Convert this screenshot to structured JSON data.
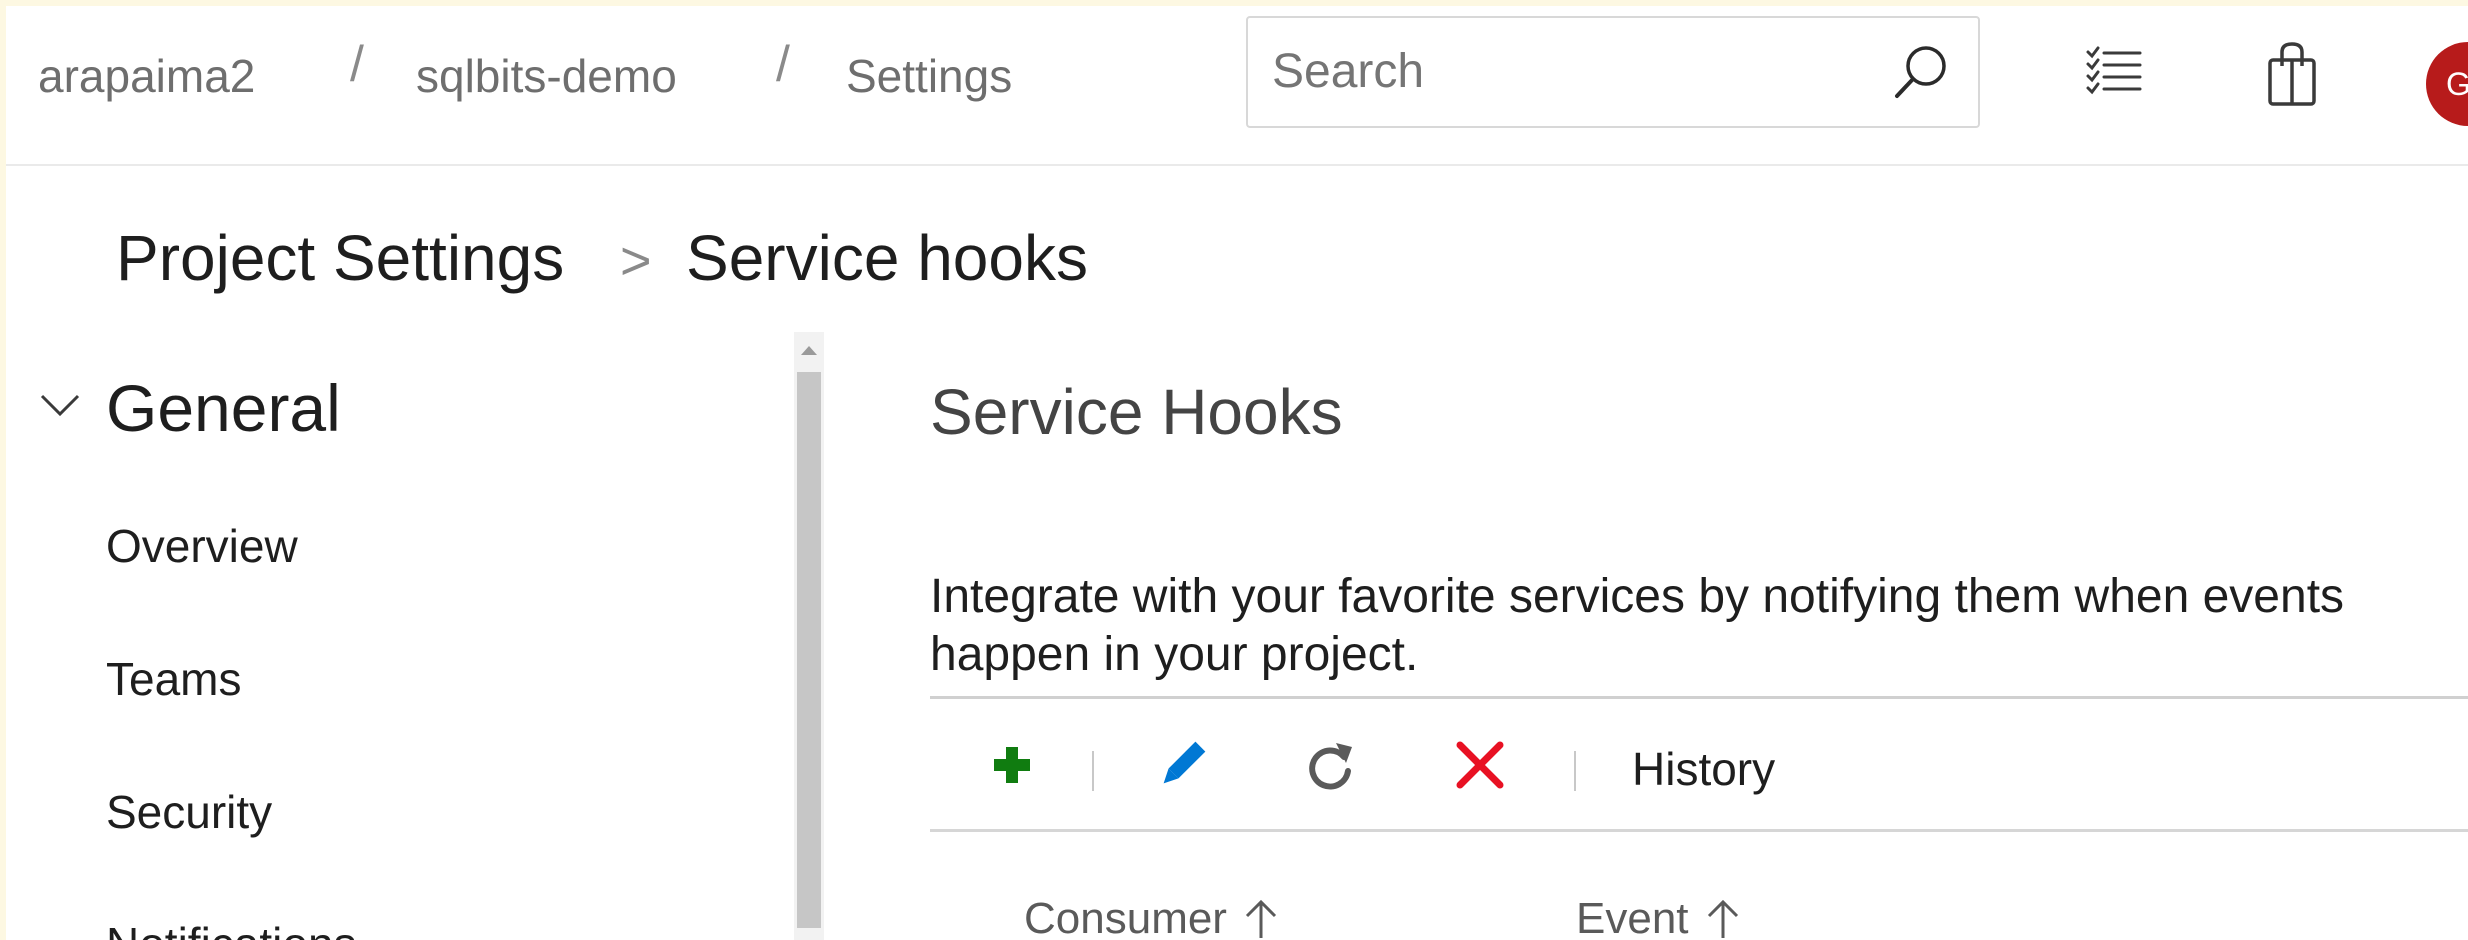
{
  "topbar": {
    "breadcrumb": [
      "arapaima2",
      "sqlbits-demo",
      "Settings"
    ],
    "separator": "/",
    "search": {
      "placeholder": "Search"
    },
    "icons": [
      "search-icon",
      "task-list-icon",
      "shopping-bag-icon"
    ],
    "avatar_initial": "G",
    "avatar_color": "#b71b1b"
  },
  "page_header": {
    "title": "Project Settings",
    "chevron": ">",
    "subtitle": "Service hooks"
  },
  "sidebar": {
    "group_label": "General",
    "items": [
      "Overview",
      "Teams",
      "Security",
      "Notifications"
    ]
  },
  "main": {
    "section_title": "Service Hooks",
    "description": "Integrate with your favorite services by notifying them when events happen in your project.",
    "toolbar": {
      "buttons": [
        "add-icon",
        "edit-icon",
        "refresh-icon",
        "delete-icon"
      ],
      "history_label": "History",
      "colors": {
        "add": "#107c10",
        "edit": "#0078d4",
        "refresh": "#5a5a5a",
        "delete": "#e81123"
      }
    },
    "columns": [
      "Consumer",
      "Event"
    ]
  }
}
